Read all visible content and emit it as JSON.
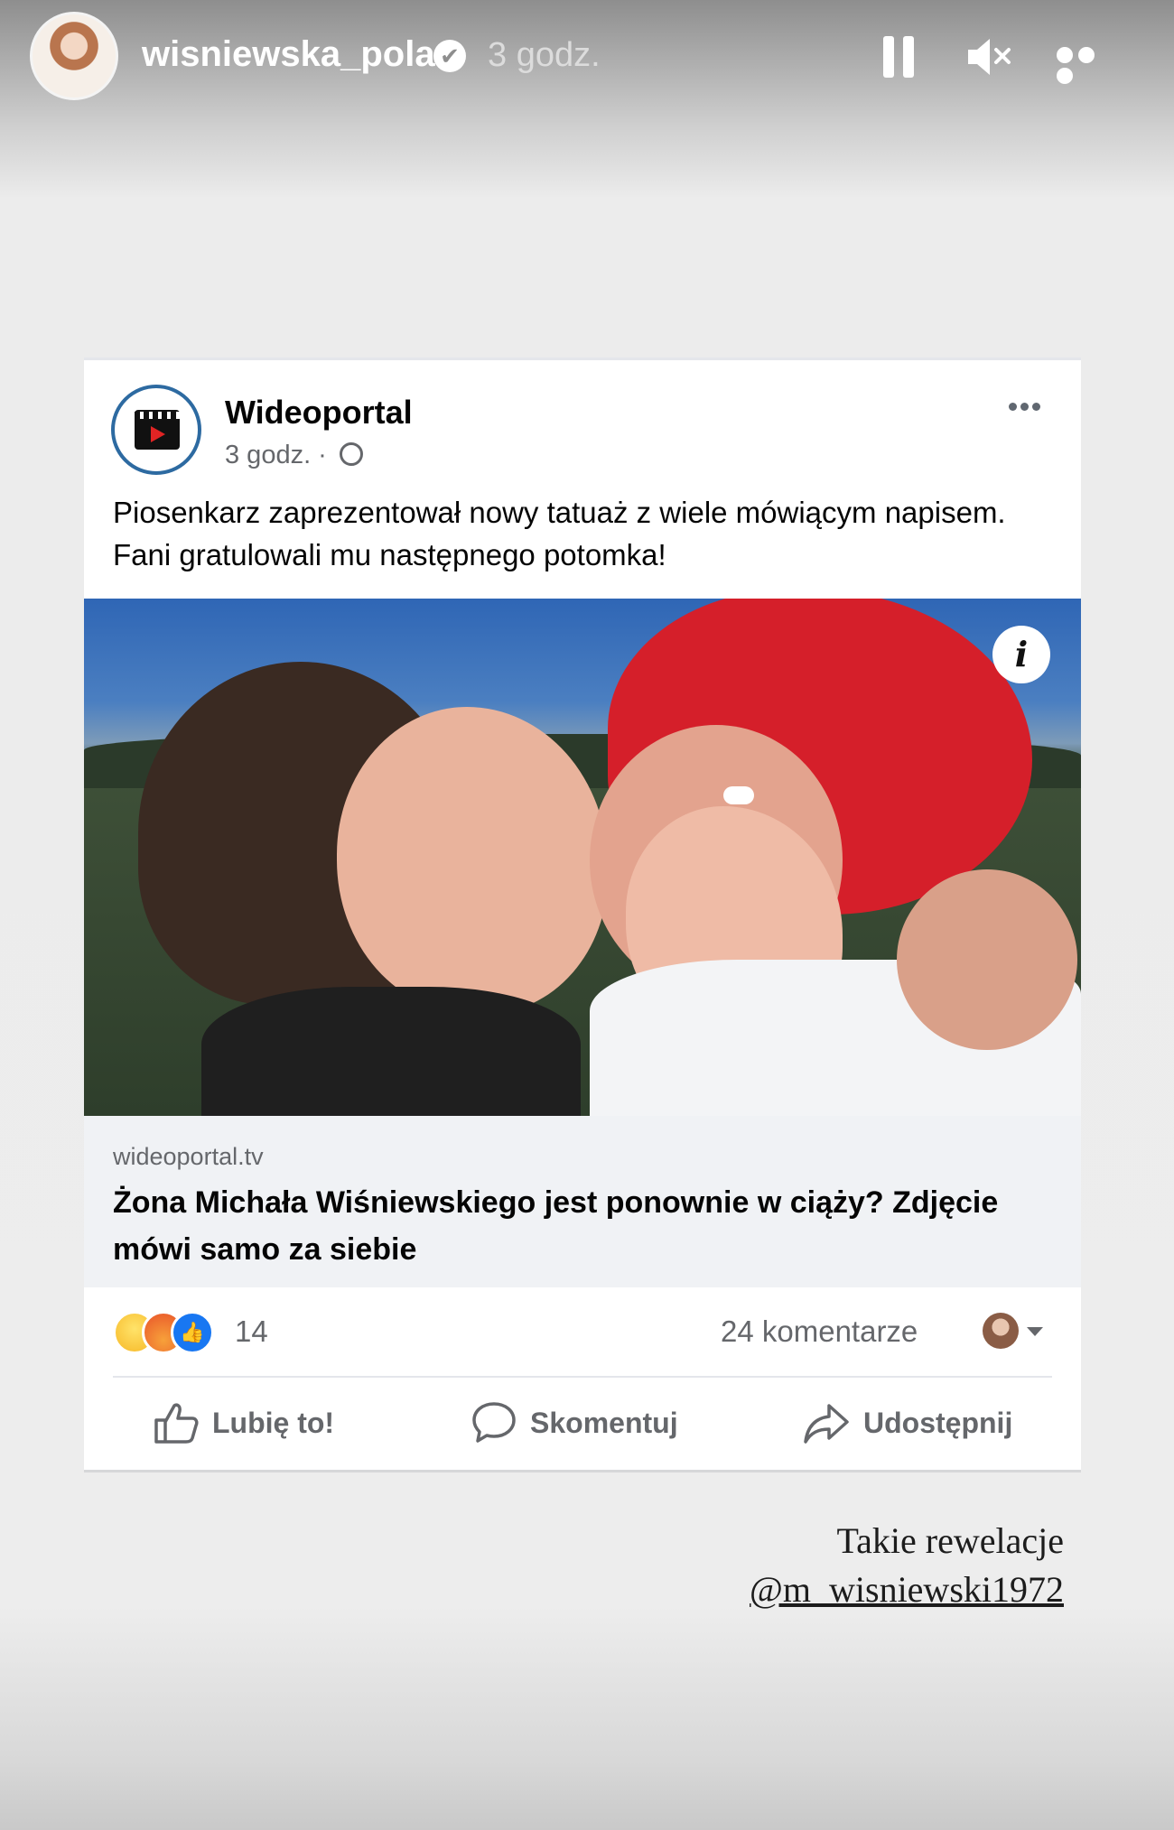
{
  "story_header": {
    "username": "wisniewska_pola",
    "verified_mark": "✔",
    "time": "3 godz."
  },
  "post": {
    "page_name": "Wideoportal",
    "time": "3 godz. ·",
    "text": "Piosenkarz zaprezentował nowy tatuaż z wiele mówiącym napisem. Fani gratulowali mu następnego potomka!",
    "link_domain": "wideoportal.tv",
    "link_title": "Żona Michała Wiśniewskiego jest ponownie w ciąży? Zdjęcie mówi samo za siebie",
    "reaction_count": "14",
    "comments": "24 komentarze",
    "actions": {
      "like": "Lubię to!",
      "comment": "Skomentuj",
      "share": "Udostępnij"
    },
    "info_glyph": "i"
  },
  "caption": {
    "line1": "Takie rewelacje",
    "mention": "@m_wisniewski1972"
  },
  "colors": {
    "facebook_blue": "#1877f2",
    "page_avatar_ring": "#2d6aa1",
    "text_secondary": "#65676b"
  },
  "icons": [
    "verified-badge-icon",
    "pause-icon",
    "mute-icon",
    "more-icon",
    "globe-icon",
    "info-icon",
    "like-thumb-icon",
    "comment-bubble-icon",
    "share-arrow-icon"
  ]
}
